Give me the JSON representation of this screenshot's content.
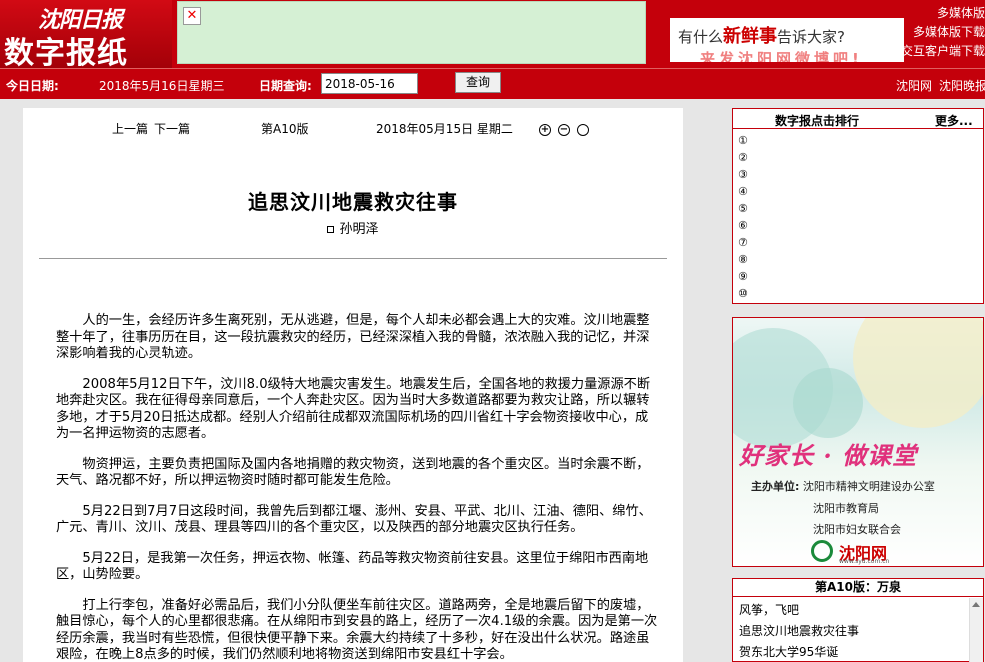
{
  "header": {
    "brand_top": "沈阳日报",
    "brand_main": "数字报纸",
    "banner_line1_pre": "有什么",
    "banner_line1_em": "新鲜事",
    "banner_line1_post": "告诉大家?",
    "banner_line2": "来发沈阳网微博吧!",
    "links": [
      "多媒体版",
      "多媒体版下载",
      "交互客户端下载"
    ]
  },
  "datebar": {
    "today_label": "今日日期:",
    "today_value": "2018年5月16日星期三",
    "query_label": "日期查询:",
    "query_value": "2018-05-16",
    "query_button": "查询",
    "right_links": [
      "沈阳网",
      "沈阳晚报"
    ]
  },
  "article": {
    "prev": "上一篇",
    "next": "下一篇",
    "page": "第A10版",
    "date": "2018年05月15日 星期二",
    "title": "追思汶川地震救灾往事",
    "author": "孙明泽",
    "paragraphs": [
      "人的一生，会经历许多生离死别，无从逃避，但是，每个人却未必都会遇上大的灾难。汶川地震整整十年了，往事历历在目，这一段抗震救灾的经历，已经深深植入我的骨髓，浓浓融入我的记忆，并深深影响着我的心灵轨迹。",
      "2008年5月12日下午，汶川8.0级特大地震灾害发生。地震发生后，全国各地的救援力量源源不断地奔赴灾区。我在征得母亲同意后，一个人奔赴灾区。因为当时大多数道路都要为救灾让路，所以辗转多地，才于5月20日抵达成都。经别人介绍前往成都双流国际机场的四川省红十字会物资接收中心，成为一名押运物资的志愿者。",
      "物资押运，主要负责把国际及国内各地捐赠的救灾物资，送到地震的各个重灾区。当时余震不断，天气、路况都不好，所以押运物资时随时都可能发生危险。",
      "5月22日到7月7日这段时间，我曾先后到都江堰、澎州、安县、平武、北川、江油、德阳、绵竹、广元、青川、汶川、茂县、理县等四川的各个重灾区，以及陕西的部分地震灾区执行任务。",
      "5月22日，是我第一次任务，押运衣物、帐篷、药品等救灾物资前往安县。这里位于绵阳市西南地区，山势险要。",
      "打上行李包，准备好必需品后，我们小分队便坐车前往灾区。道路两旁，全是地震后留下的废墟，触目惊心，每个人的心里都很悲痛。在从绵阳市到安县的路上，经历了一次4.1级的余震。因为是第一次经历余震，我当时有些恐慌，但很快便平静下来。余震大约持续了十多秒，好在没出什么状况。路途虽艰险，在晚上8点多的时候，我们仍然顺利地将物资送到绵阳市安县红十字会。"
    ]
  },
  "rank": {
    "title": "数字报点击排行",
    "more": "更多...",
    "numbers": [
      "①",
      "②",
      "③",
      "④",
      "⑤",
      "⑥",
      "⑦",
      "⑧",
      "⑨",
      "⑩"
    ]
  },
  "promo": {
    "slogan": "好家长 · 做课堂",
    "org_label": "主办单位:",
    "orgs": [
      "沈阳市精神文明建设办公室",
      "沈阳市教育局",
      "沈阳市妇女联合会"
    ],
    "logo": "沈阳网",
    "url": "www.syd.com.cn"
  },
  "edition": {
    "title": "第A10版：万泉",
    "items": [
      "风筝，飞吧",
      "追思汶川地震救灾往事",
      "贺东北大学95华诞"
    ]
  }
}
